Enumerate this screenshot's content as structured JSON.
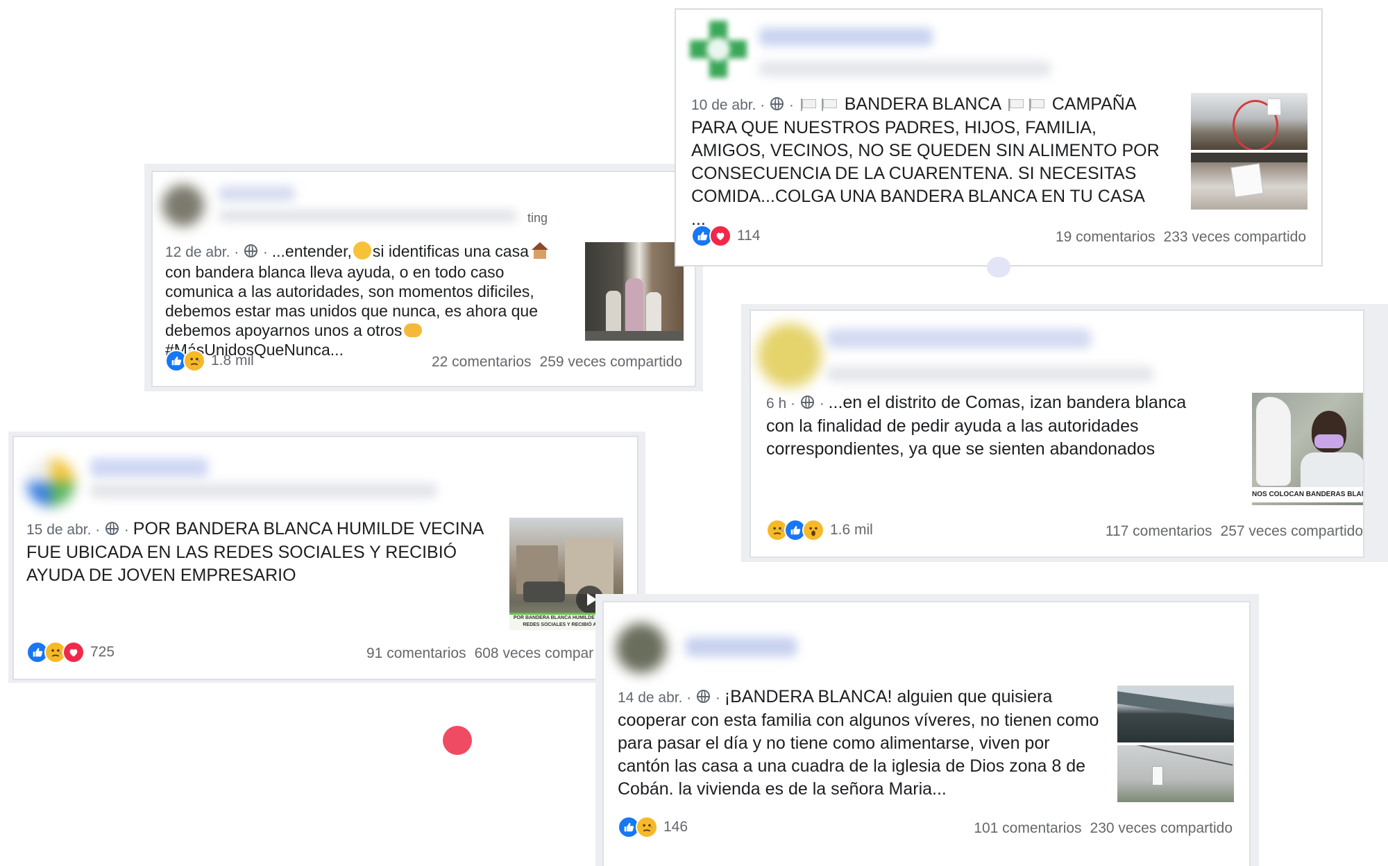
{
  "posts": [
    {
      "id": "post-12abr",
      "date": "12 de abr.",
      "header_fragment": "ting",
      "text_a": "...entender,",
      "text_b": "si identificas una casa",
      "text_c": "con bandera blanca lleva ayuda, o en todo caso comunica a las autoridades, son momentos dificiles, debemos estar mas unidos que nunca, es ahora que debemos apoyarnos unos a otros",
      "text_d": "#MásUnidosQueNunca...",
      "reactions": [
        "like",
        "sad"
      ],
      "reaction_count": "1.8 mil",
      "comments": "22 comentarios",
      "shares": "259 veces compartido"
    },
    {
      "id": "post-10abr",
      "date": "10 de abr.",
      "text_a": "BANDERA BLANCA",
      "text_b": "CAMPAÑA PARA QUE NUESTROS PADRES, HIJOS, FAMILIA, AMIGOS, VECINOS, NO SE QUEDEN SIN ALIMENTO POR CONSECUENCIA DE LA CUARENTENA. SI NECESITAS COMIDA...COLGA UNA BANDERA BLANCA EN TU CASA ...",
      "reactions": [
        "like",
        "love"
      ],
      "reaction_count": "114",
      "comments": "19 comentarios",
      "shares": "233 veces compartido"
    },
    {
      "id": "post-6h",
      "date": "6 h",
      "text": "...en el distrito de Comas, izan bandera blanca con la finalidad de pedir ayuda a las autoridades correspondientes, ya que se sienten abandonados",
      "caption": "NOS COLOCAN BANDERAS BLANCAS PARA",
      "reactions": [
        "sad",
        "like",
        "wow"
      ],
      "reaction_count": "1.6 mil",
      "comments": "117 comentarios",
      "shares": "257 veces compartido"
    },
    {
      "id": "post-15abr",
      "date": "15 de abr.",
      "text": "POR BANDERA BLANCA HUMILDE VECINA FUE UBICADA EN LAS REDES SOCIALES Y RECIBIÓ AYUDA DE JOVEN EMPRESARIO",
      "caption": "POR BANDERA BLANCA HUMILDE ... EN LAS REDES SOCIALES Y RECIBIÓ AYUDA",
      "reactions": [
        "like",
        "sad",
        "love"
      ],
      "reaction_count": "725",
      "comments": "91 comentarios",
      "shares": "608 veces compar"
    },
    {
      "id": "post-14abr",
      "date": "14 de abr.",
      "text": "¡BANDERA BLANCA! alguien que quisiera cooperar con esta familia con algunos víveres, no tienen como para pasar el día y no tiene como alimentarse, viven por cantón las casa a una cuadra de la iglesia de Dios zona 8 de Cobán. la vivienda es de la señora Maria...",
      "reactions": [
        "like",
        "sad"
      ],
      "reaction_count": "146",
      "comments": "101 comentarios",
      "shares": "230 veces compartido"
    }
  ],
  "icons": {
    "privacy": "globe-icon",
    "flag": "white-flag-icon",
    "like": "like-reaction-icon",
    "love": "love-reaction-icon",
    "sad": "sad-reaction-icon",
    "wow": "wow-reaction-icon",
    "play": "play-icon"
  },
  "colors": {
    "like": "#1877f2",
    "love": "#f02849",
    "emoji": "#f7b928",
    "meta_text": "#65676b",
    "red_dot": "#ef4b63",
    "lavender_dot": "#e3e4f8"
  }
}
